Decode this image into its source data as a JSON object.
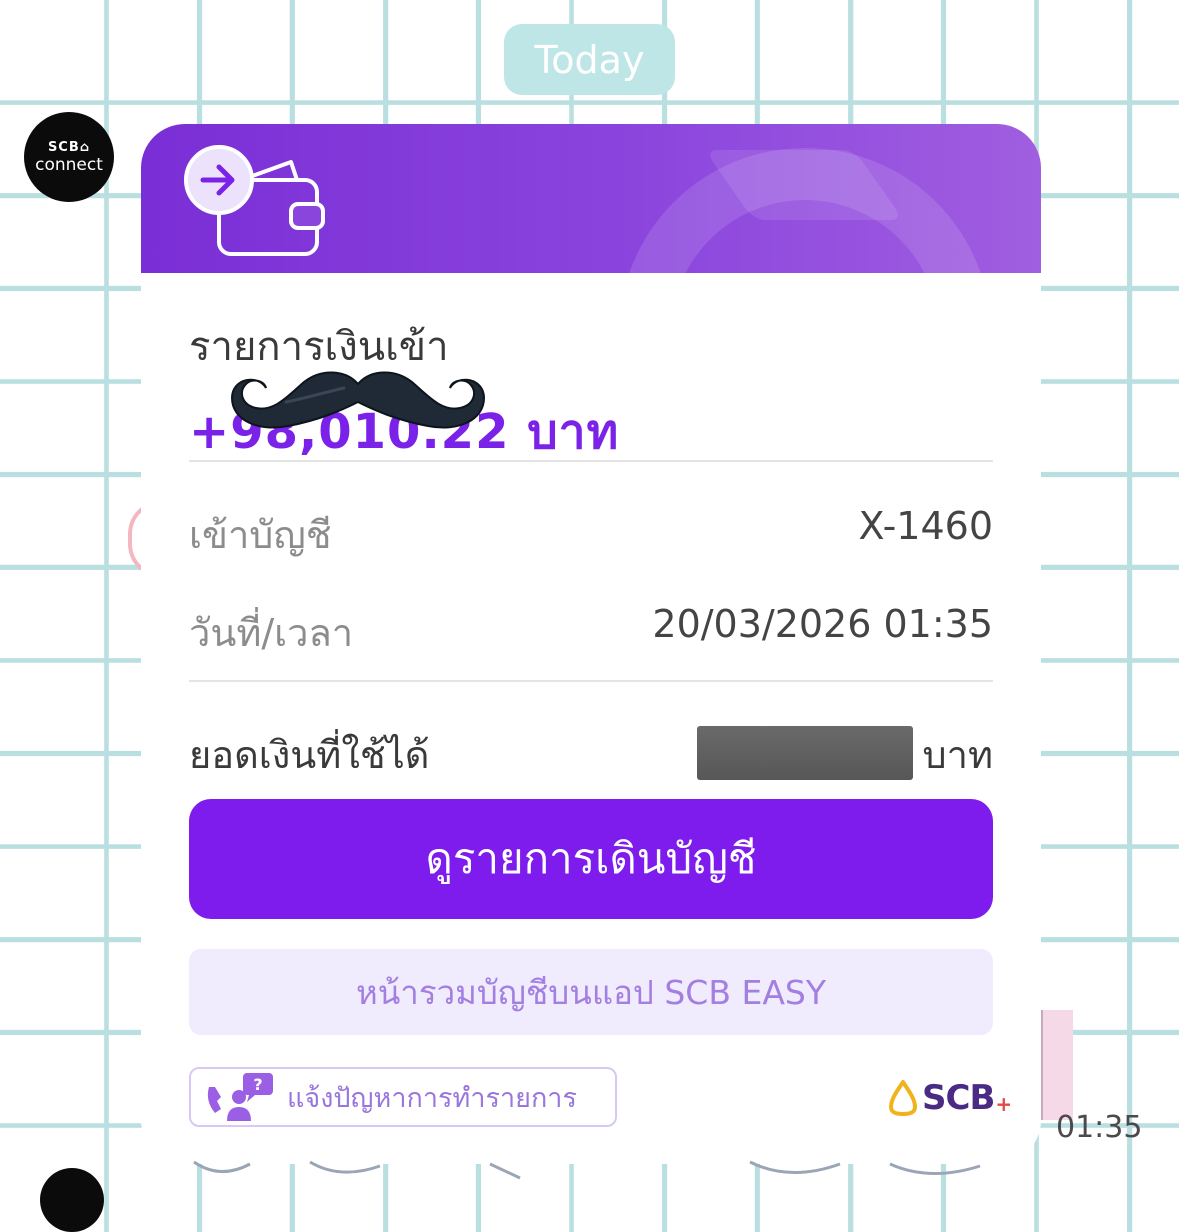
{
  "chat": {
    "date_label": "Today",
    "sender_logo_line1": "SCB⌂",
    "sender_logo_line2": "connect",
    "time": "01:35"
  },
  "card": {
    "title": "รายการเงินเข้า",
    "amount_text": "+98,010.22 บาท",
    "account_label": "เข้าบัญชี",
    "account_value": "X-1460",
    "datetime_label": "วันที่/เวลา",
    "datetime_value": "20/03/2026 01:35",
    "balance_label": "ยอดเงินที่ใช้ได้",
    "balance_unit": "บาท",
    "primary_button": "ดูรายการเดินบัญชี",
    "secondary_button": "หน้ารวมบัญชีบนแอป SCB EASY",
    "report_button": "แจ้งปัญหาการทำรายการ",
    "brand_text": "SCB",
    "brand_plus": "+"
  },
  "icons": {
    "header": "wallet-incoming-icon",
    "report": "support-chat-icon",
    "brand": "scb-logo-icon",
    "overlay": "mustache-sticker"
  },
  "colors": {
    "header_purple": "#7a2ed6",
    "primary_purple": "#7d1ced",
    "amount_purple": "#7b22e8",
    "secondary_bg": "#f0ebfd",
    "grid_line": "#b9dfe0",
    "date_pill": "#bfe6e7"
  }
}
